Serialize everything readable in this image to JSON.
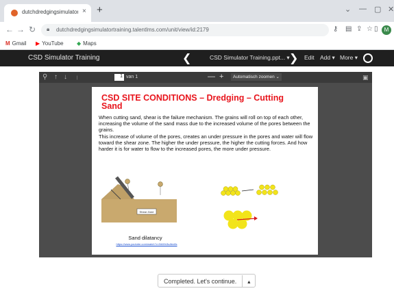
{
  "browser": {
    "tab_title": "dutchdredgingsimulatortraining",
    "tab_close": "×",
    "new_tab": "+",
    "window_buttons": [
      "⌄",
      "—",
      "▢",
      "✕"
    ],
    "url": "dutchdredgingsimulatortraining.talentlms.com/unit/view/id:2179",
    "bookmarks": [
      {
        "label": "Gmail",
        "icon": "M",
        "color": "#d93025"
      },
      {
        "label": "YouTube",
        "icon": "▶",
        "color": "#ff0000"
      },
      {
        "label": "Maps",
        "icon": "◆",
        "color": "#34a853"
      }
    ],
    "profile_initial": "M"
  },
  "app": {
    "title": "CSD Simulator Training",
    "unit_title": "CSD Simulator Training.ppt... ▾",
    "prev": "❮",
    "next": "❯",
    "edit": "Edit",
    "add": "Add ▾",
    "more": "More ▾"
  },
  "pdf": {
    "page_number": "1",
    "page_of": "van 1",
    "zoom_out": "—",
    "zoom_in": "+",
    "zoom_label": "Automatisch zoomen",
    "zoom_caret": "⌄"
  },
  "slide": {
    "title": "CSD SITE CONDITIONS – Dredging – Cutting Sand",
    "paragraph1": "When cutting sand, shear is the failure mechanism. The grains will roll on top of each other, increasing the volume of the sand mass due to the increased volume of the pores between the grains.",
    "paragraph2": "This increase of volume of the pores, creates an under pressure in the pores and water will flow toward the shear zone. The higher the under pressure, the higher the cutting forces. And how harder it is for water to flow to the increased pores, the more under pressure.",
    "figure_label": "Shear Zone",
    "figure_caption": "Sand dilatancy",
    "figure_link": "https://www.youtube.com/watch?v=NkWn3uAbx8s"
  },
  "footer": {
    "continue_label": "Completed. Let's continue.",
    "continue_caret": "▲"
  },
  "colors": {
    "title_red": "#e8141c",
    "sand": "#c9a96e",
    "grain_yellow": "#f2e41a",
    "arrow_red": "#d71a1a"
  }
}
